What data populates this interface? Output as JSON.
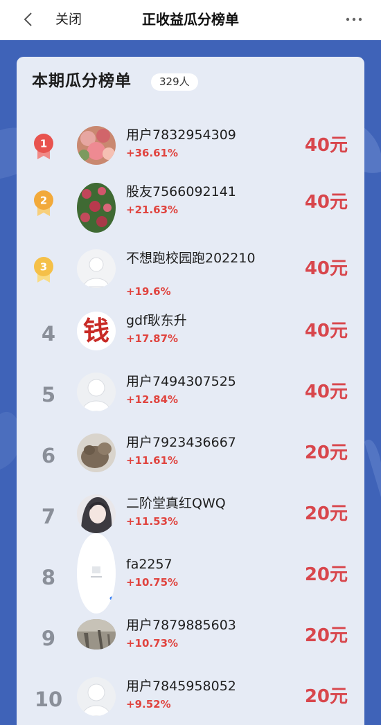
{
  "nav": {
    "back_icon": "chevron-left-icon",
    "close_label": "关闭",
    "title": "正收益瓜分榜单",
    "more_icon": "more-dots-icon"
  },
  "card": {
    "title": "本期瓜分榜单",
    "count": "329人"
  },
  "colors": {
    "background": "#3f63b8",
    "card": "#e6ebf5",
    "gain": "#e0443f",
    "prize": "#d8464c",
    "gold": "#f5b63a",
    "red_medal": "#e8534f"
  },
  "rows": [
    {
      "rank": "1",
      "name": "用户7832954309",
      "gain": "+36.61%",
      "prize": "40元"
    },
    {
      "rank": "2",
      "name": "股友7566092141",
      "gain": "+21.63%",
      "prize": "40元"
    },
    {
      "rank": "3",
      "name": "不想跑校园跑202210",
      "gain": "+19.6%",
      "prize": "40元"
    },
    {
      "rank": "4",
      "name": "gdf耿东升",
      "gain": "+17.87%",
      "prize": "40元",
      "avatar_text": "钱"
    },
    {
      "rank": "5",
      "name": "用户7494307525",
      "gain": "+12.84%",
      "prize": "40元"
    },
    {
      "rank": "6",
      "name": "用户7923436667",
      "gain": "+11.61%",
      "prize": "20元"
    },
    {
      "rank": "7",
      "name": "二阶堂真红QWQ",
      "gain": "+11.53%",
      "prize": "20元"
    },
    {
      "rank": "8",
      "name": "fa2257",
      "gain": "+10.75%",
      "prize": "20元"
    },
    {
      "rank": "9",
      "name": "用户7879885603",
      "gain": "+10.73%",
      "prize": "20元"
    },
    {
      "rank": "10",
      "name": "用户7845958052",
      "gain": "+9.52%",
      "prize": "20元"
    }
  ]
}
